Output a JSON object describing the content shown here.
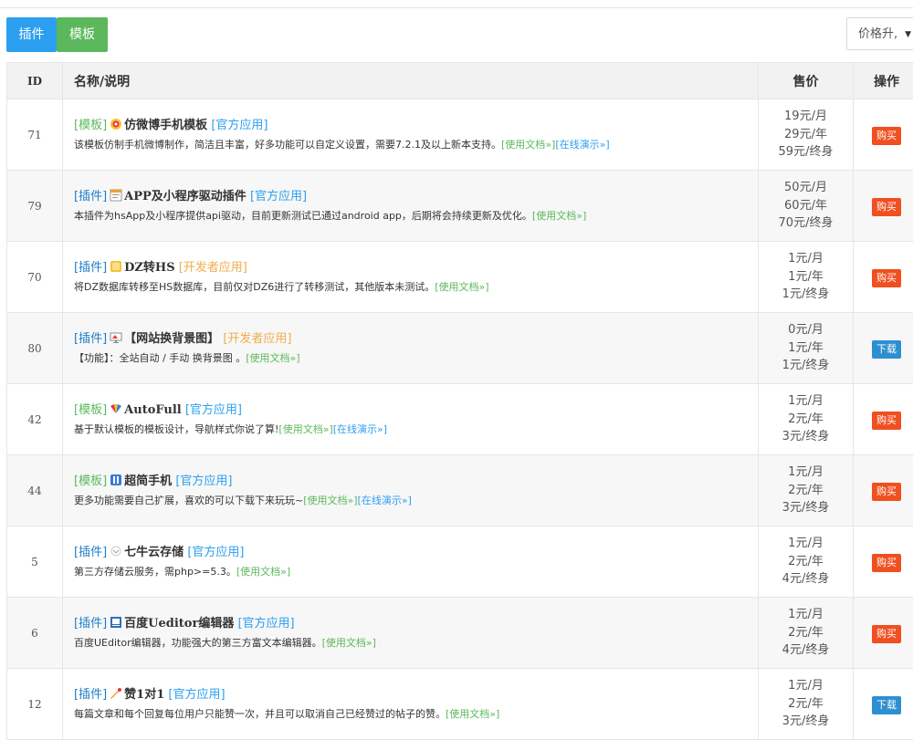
{
  "toolbar": {
    "plugin_label": "插件",
    "theme_label": "模板",
    "sort_selected": "价格升,"
  },
  "table": {
    "headers": {
      "id": "ID",
      "name": "名称/说明",
      "price": "售价",
      "action": "操作"
    },
    "rows": [
      {
        "id": "71",
        "type": "[模板]",
        "type_kind": "theme",
        "icon": "weibo-icon",
        "title": "仿微博手机模板",
        "source": "[官方应用]",
        "source_kind": "official",
        "desc": "该模板仿制手机微博制作，简洁且丰富，好多功能可以自定义设置，需要7.2.1及以上新本支持。",
        "doc": "[使用文档»]",
        "demo": "[在线演示»]",
        "prices": [
          "19元/月",
          "29元/年",
          "59元/终身"
        ],
        "action": "购买",
        "action_kind": "buy"
      },
      {
        "id": "79",
        "type": "[插件]",
        "type_kind": "plugin",
        "icon": "app-window-icon",
        "title": "APP及小程序驱动插件",
        "source": "[官方应用]",
        "source_kind": "official",
        "desc": "本插件为hsApp及小程序提供api驱动，目前更新测试已通过android app，后期将会持续更新及优化。",
        "doc": "[使用文档»]",
        "demo": "",
        "prices": [
          "50元/月",
          "60元/年",
          "70元/终身"
        ],
        "action": "购买",
        "action_kind": "buy"
      },
      {
        "id": "70",
        "type": "[插件]",
        "type_kind": "plugin",
        "icon": "convert-icon",
        "title": "DZ转HS",
        "source": "[开发者应用]",
        "source_kind": "dev",
        "desc": "将DZ数据库转移至HS数据库，目前仅对DZ6进行了转移测试，其他版本未测试。",
        "doc": "[使用文档»]",
        "demo": "",
        "prices": [
          "1元/月",
          "1元/年",
          "1元/终身"
        ],
        "action": "购买",
        "action_kind": "buy"
      },
      {
        "id": "80",
        "type": "[插件]",
        "type_kind": "plugin",
        "icon": "monitor-icon",
        "title": "【网站换背景图】",
        "source": "[开发者应用]",
        "source_kind": "dev",
        "desc": "【功能】：全站自动 / 手动 换背景图 。",
        "doc": "[使用文档»]",
        "demo": "",
        "prices": [
          "0元/月",
          "1元/年",
          "1元/终身"
        ],
        "action": "下载",
        "action_kind": "download"
      },
      {
        "id": "42",
        "type": "[模板]",
        "type_kind": "theme",
        "icon": "colorful-fan-icon",
        "title": "AutoFull",
        "source": "[官方应用]",
        "source_kind": "official",
        "desc": "基于默认模板的模板设计，导航样式你说了算!",
        "doc": "[使用文档»]",
        "demo": "[在线演示»]",
        "prices": [
          "1元/月",
          "2元/年",
          "3元/终身"
        ],
        "action": "购买",
        "action_kind": "buy"
      },
      {
        "id": "44",
        "type": "[模板]",
        "type_kind": "theme",
        "icon": "hs-logo-icon",
        "title": "超简手机",
        "source": "[官方应用]",
        "source_kind": "official",
        "desc": "更多功能需要自己扩展，喜欢的可以下载下来玩玩~",
        "doc": "[使用文档»]",
        "demo": "[在线演示»]",
        "prices": [
          "1元/月",
          "2元/年",
          "3元/终身"
        ],
        "action": "购买",
        "action_kind": "buy"
      },
      {
        "id": "5",
        "type": "[插件]",
        "type_kind": "plugin",
        "icon": "qiniu-cloud-icon",
        "title": "七牛云存储",
        "source": "[官方应用]",
        "source_kind": "official",
        "desc": "第三方存储云服务，需php>=5.3。",
        "doc": "[使用文档»]",
        "demo": "",
        "prices": [
          "1元/月",
          "2元/年",
          "4元/终身"
        ],
        "action": "购买",
        "action_kind": "buy"
      },
      {
        "id": "6",
        "type": "[插件]",
        "type_kind": "plugin",
        "icon": "editor-icon",
        "title": "百度Ueditor编辑器",
        "source": "[官方应用]",
        "source_kind": "official",
        "desc": "百度UEditor编辑器，功能强大的第三方富文本编辑器。",
        "doc": "[使用文档»]",
        "demo": "",
        "prices": [
          "1元/月",
          "2元/年",
          "4元/终身"
        ],
        "action": "购买",
        "action_kind": "buy"
      },
      {
        "id": "12",
        "type": "[插件]",
        "type_kind": "plugin",
        "icon": "thumbs-up-icon",
        "title": "赞1对1",
        "source": "[官方应用]",
        "source_kind": "official",
        "desc": "每篇文章和每个回复每位用户只能赞一次，并且可以取消自己已经赞过的帖子的赞。",
        "doc": "[使用文档»]",
        "demo": "",
        "prices": [
          "1元/月",
          "2元/年",
          "3元/终身"
        ],
        "action": "下载",
        "action_kind": "download"
      }
    ]
  }
}
